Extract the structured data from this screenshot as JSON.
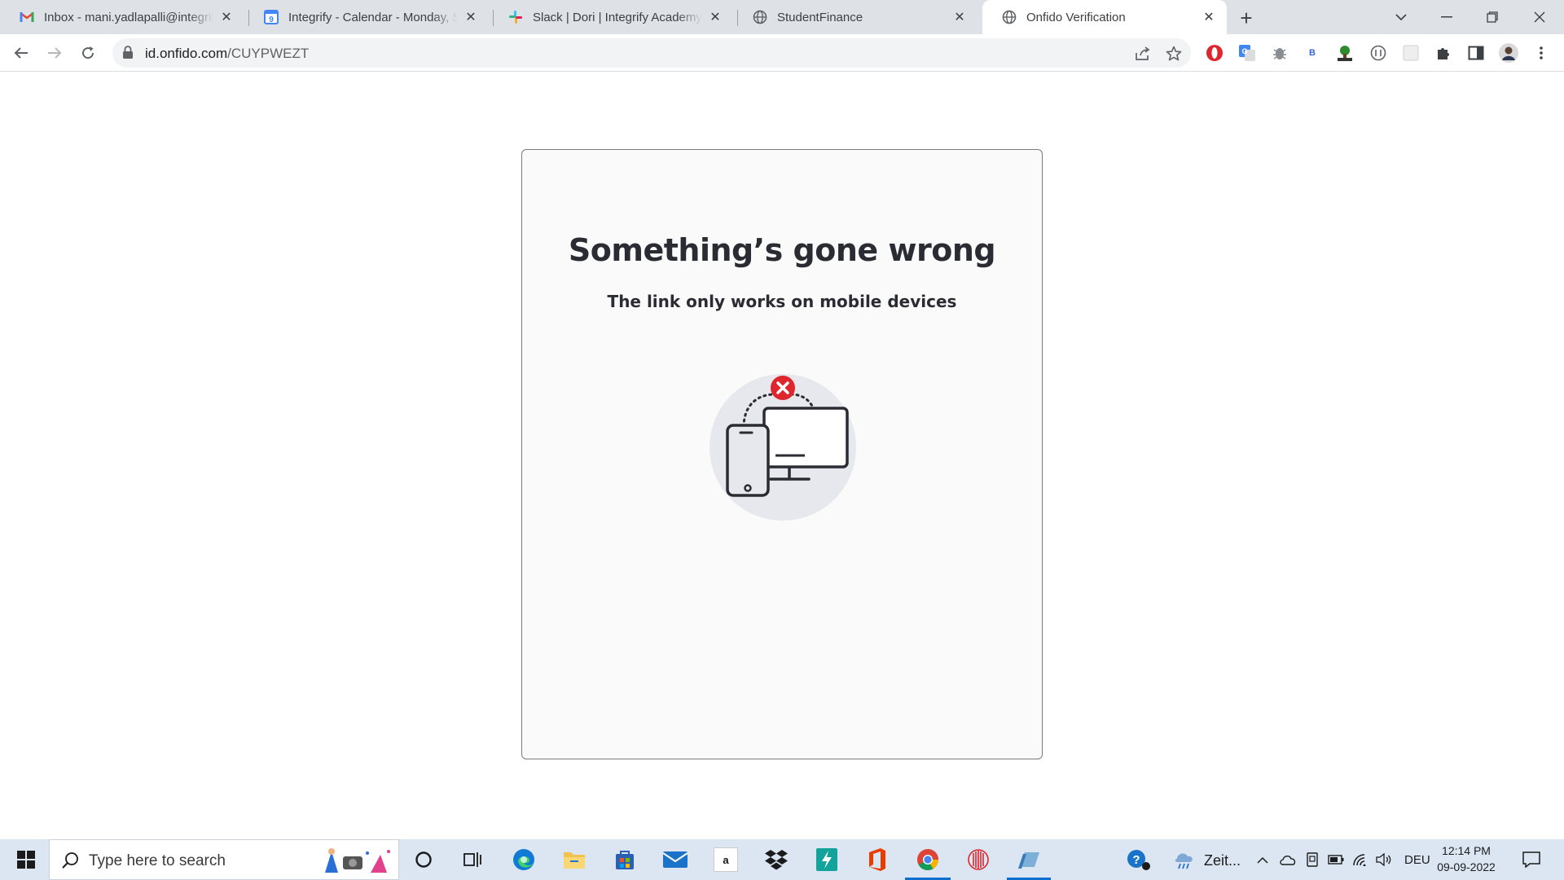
{
  "browser": {
    "tabs": [
      {
        "title": "Inbox - mani.yadlapalli@integrify",
        "icon": "gmail-icon",
        "active": false
      },
      {
        "title": "Integrify - Calendar - Monday, Se",
        "icon": "google-calendar-icon",
        "calendar_day": "9",
        "active": false
      },
      {
        "title": "Slack | Dori | Integrify Academy",
        "icon": "slack-icon",
        "active": false
      },
      {
        "title": "StudentFinance",
        "icon": "globe-icon",
        "active": false
      },
      {
        "title": "Onfido Verification",
        "icon": "globe-icon",
        "active": true
      }
    ],
    "address": {
      "host": "id.onfido.com",
      "path": "/CUYPWEZT"
    },
    "extensions": {
      "b_label": "B"
    }
  },
  "page": {
    "title": "Something’s gone wrong",
    "subtitle": "The link only works on mobile devices"
  },
  "taskbar": {
    "search_placeholder": "Type here to search",
    "weather_label": "Zeit...",
    "language": "DEU",
    "time": "12:14 PM",
    "date": "09-09-2022",
    "amazon_label": "a"
  },
  "colors": {
    "error_red": "#e0262d",
    "accent_blue": "#0a6ed1"
  }
}
